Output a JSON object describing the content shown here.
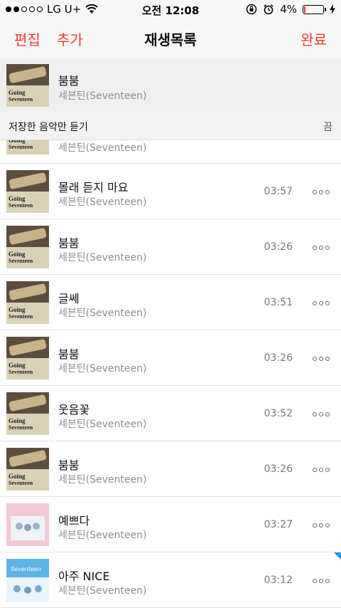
{
  "status": {
    "carrier": "LG U+",
    "time": "오전 12:08",
    "battery": "4%",
    "signal_bars_filled": 2,
    "signal_bars_total": 5
  },
  "nav": {
    "edit": "편집",
    "add": "추가",
    "title": "재생목록",
    "done": "완료"
  },
  "now_playing": {
    "title": "붐붐",
    "artist": "세븐틴(Seventeen)"
  },
  "offline": {
    "label": "저장한 음악만 듣기",
    "state": "끔"
  },
  "partial_row": {
    "artist": "세븐틴(Seventeen)"
  },
  "tracks": [
    {
      "title": "몰래 듣지 마요",
      "artist": "세븐틴(Seventeen)",
      "duration": "03:57",
      "cover": "going"
    },
    {
      "title": "붐붐",
      "artist": "세븐틴(Seventeen)",
      "duration": "03:26",
      "cover": "going"
    },
    {
      "title": "글쎄",
      "artist": "세븐틴(Seventeen)",
      "duration": "03:51",
      "cover": "going"
    },
    {
      "title": "붐붐",
      "artist": "세븐틴(Seventeen)",
      "duration": "03:26",
      "cover": "going"
    },
    {
      "title": "웃음꽃",
      "artist": "세븐틴(Seventeen)",
      "duration": "03:52",
      "cover": "going"
    },
    {
      "title": "붐붐",
      "artist": "세븐틴(Seventeen)",
      "duration": "03:26",
      "cover": "going"
    },
    {
      "title": "예쁘다",
      "artist": "세븐틴(Seventeen)",
      "duration": "03:27",
      "cover": "pink"
    },
    {
      "title": "아주 NICE",
      "artist": "세븐틴(Seventeen)",
      "duration": "03:12",
      "cover": "blue"
    }
  ],
  "covers": {
    "going_line1": "Going",
    "going_line2": "Seventeen",
    "blue_text": "Seventeen"
  },
  "colors": {
    "accent": "#ff3b30",
    "secondary_text": "#8e8e93",
    "marker": "#2196f3"
  }
}
